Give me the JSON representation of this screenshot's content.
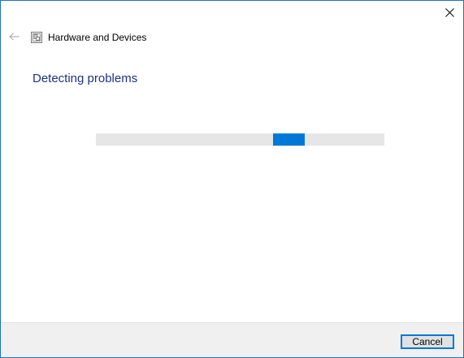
{
  "window": {
    "title": "Hardware and Devices",
    "accent_color": "#0078d7",
    "border_color": "#1a73c7"
  },
  "icons": {
    "close": "close-icon",
    "back": "back-arrow-icon",
    "app": "troubleshooter-icon"
  },
  "main": {
    "heading": "Detecting problems",
    "heading_color": "#1e3287"
  },
  "progress": {
    "state": "indeterminate",
    "chunk_start_fraction": 0.615,
    "chunk_width_fraction": 0.11
  },
  "footer": {
    "cancel_label": "Cancel"
  }
}
